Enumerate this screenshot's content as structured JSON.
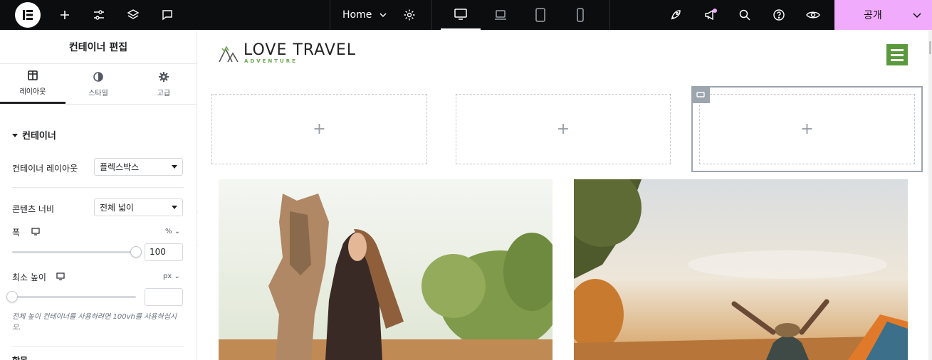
{
  "topbar": {
    "page_name": "Home",
    "publish_label": "공개",
    "accent_color": "#f0abfc",
    "icons": [
      "elementor-logo-icon",
      "add-icon",
      "settings-sliders-icon",
      "layers-icon",
      "comments-icon",
      "page-settings-gear-icon",
      "desktop-icon",
      "laptop-icon",
      "tablet-icon",
      "mobile-icon",
      "rocket-icon",
      "megaphone-icon",
      "search-icon",
      "help-icon",
      "preview-eye-icon",
      "chevron-down-icon"
    ]
  },
  "panel": {
    "title": "컨테이너 편집",
    "tabs": [
      {
        "label": "레이아웃",
        "icon": "layout-icon",
        "active": true
      },
      {
        "label": "스타일",
        "icon": "style-half-circle-icon",
        "active": false
      },
      {
        "label": "고급",
        "icon": "gear-icon",
        "active": false
      }
    ],
    "section_title": "컨테이너",
    "container_layout_label": "컨테이너 레이아웃",
    "container_layout_value": "플렉스박스",
    "content_width_label": "콘텐츠 너비",
    "content_width_value": "전체 넓이",
    "width_label": "폭",
    "width_unit": "%",
    "width_value": "100",
    "width_slider_fraction": 1.0,
    "min_height_label": "최소 높이",
    "min_height_unit": "px",
    "min_height_value": "",
    "min_height_slider_fraction": 0.0,
    "hint": "전체 높이 컨테이너를 사용하려면 100vh를 사용하십시오.",
    "next_section_partial": "항목"
  },
  "canvas": {
    "brand_name": "LOVE TRAVEL",
    "brand_tagline": "ADVENTURE",
    "brand_color": "#5b9a3c",
    "drop_zones": [
      "+",
      "+",
      "+"
    ]
  }
}
